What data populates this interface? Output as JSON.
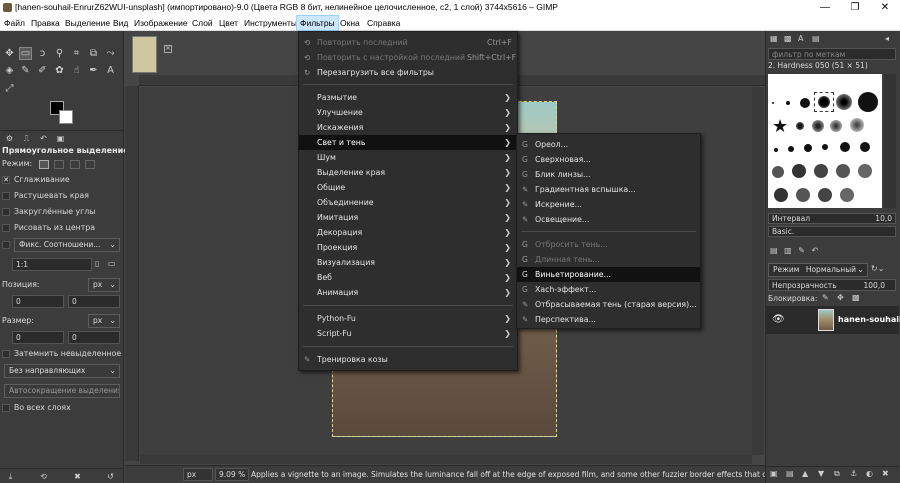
{
  "window": {
    "title": "[hanen-souhail-EnrurZ62WUI-unsplash] (импортировано)-9.0 (Цвета RGB 8 бит, нелинейное целочисленное, c2, 1 слой) 3744x5616 – GIMP",
    "minimize": "—",
    "maximize": "❐",
    "close": "✕"
  },
  "menubar": [
    "Файл",
    "Правка",
    "Выделение",
    "Вид",
    "Изображение",
    "Слой",
    "Цвет",
    "Инструменты",
    "Фильтры",
    "Окна",
    "Справка"
  ],
  "menubar_active_index": 8,
  "toolbox": {
    "tool_options_title": "Прямоугольное выделение",
    "mode_label": "Режим:",
    "antialias": "Сглаживание",
    "feather": "Растушевать края",
    "rounded": "Закруглённые углы",
    "from_center": "Рисовать из центра",
    "fixed": "Фикс. Соотношени...",
    "ratio_value": "1:1",
    "position_label": "Позиция:",
    "position_unit": "px",
    "position_x": "0",
    "position_y": "0",
    "size_label": "Размер:",
    "size_unit": "px",
    "size_w": "0",
    "size_h": "0",
    "highlight": "Затемнить невыделенное",
    "guides": "Без направляющих",
    "autoshrink": "Автосокращение выделения",
    "all_layers": "Во всех слоях"
  },
  "filters_menu": {
    "top": [
      {
        "label": "Повторить последний",
        "accel": "Ctrl+F",
        "disabled": true
      },
      {
        "label": "Повторить с настройкой последний",
        "accel": "Shift+Ctrl+F",
        "disabled": true
      },
      {
        "label": "Перезагрузить все фильтры",
        "accel": "",
        "disabled": false
      }
    ],
    "groups": [
      "Размытие",
      "Улучшение",
      "Искажения",
      "Свет и тень",
      "Шум",
      "Выделение края",
      "Общие",
      "Объединение",
      "Имитация",
      "Декорация",
      "Проекция",
      "Визуализация",
      "Веб",
      "Анимация"
    ],
    "highlighted_group_index": 3,
    "scripts": [
      "Python-Fu",
      "Script-Fu"
    ],
    "goat": "Тренировка козы"
  },
  "light_shadow_menu": {
    "items": [
      {
        "label": "Ореол...",
        "disabled": false
      },
      {
        "label": "Сверхновая...",
        "disabled": false
      },
      {
        "label": "Блик линзы...",
        "disabled": false
      },
      {
        "label": "Градиентная вспышка...",
        "disabled": false
      },
      {
        "label": "Искрение...",
        "disabled": false
      },
      {
        "label": "Освещение...",
        "disabled": false
      },
      {
        "label": "Отбросить тень...",
        "disabled": true
      },
      {
        "label": "Длинная тень...",
        "disabled": true
      },
      {
        "label": "Виньетирование...",
        "disabled": false
      },
      {
        "label": "Xach-эффект...",
        "disabled": false
      },
      {
        "label": "Отбрасываемая тень (старая версия)...",
        "disabled": false
      },
      {
        "label": "Перспектива...",
        "disabled": false
      }
    ],
    "highlighted_index": 8
  },
  "statusbar": {
    "unit": "px",
    "zoom": "9.09 %",
    "message": "Applies a vignette to an image. Simulates the luminance fall off at the edge of exposed film, and some other fuzzier border effects that can natura..."
  },
  "brushes": {
    "filter_placeholder": "фильтр по меткам",
    "current": "2. Hardness 050 (51 × 51)",
    "interval_label": "Интервал",
    "interval_value": "10,0",
    "preset": "Basic."
  },
  "layers": {
    "mode_label": "Режим",
    "mode_value": "Нормальный",
    "opacity_label": "Непрозрачность",
    "opacity_value": "100,0",
    "lock_label": "Блокировка:",
    "layer_name": "hanen-souhail"
  }
}
